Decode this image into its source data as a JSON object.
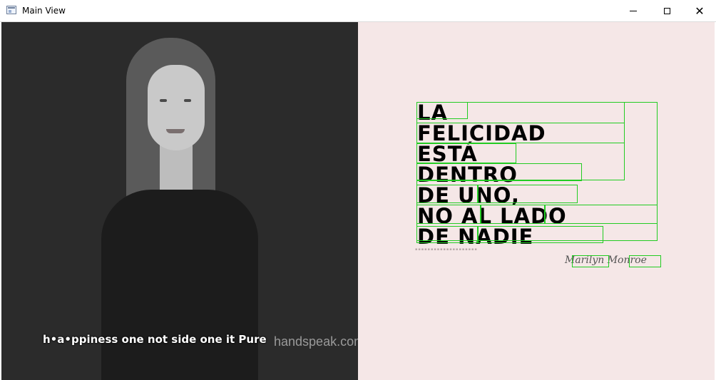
{
  "window": {
    "title": "Main View",
    "minimize_icon": "minimize-icon",
    "maximize_icon": "maximize-icon",
    "close_icon": "close-icon",
    "close_glyph": "✕"
  },
  "video": {
    "caption": "h•a•ppiness one not side one it Pure",
    "watermark": "handspeak.com"
  },
  "poster": {
    "lines": [
      "LA",
      "FELICIDAD",
      "ESTÁ",
      "DENTRO",
      "DE UNO,",
      "NO AL LADO",
      "DE NADIE"
    ],
    "signature": "Marilyn Monroe",
    "box_color": "#22cc22"
  }
}
